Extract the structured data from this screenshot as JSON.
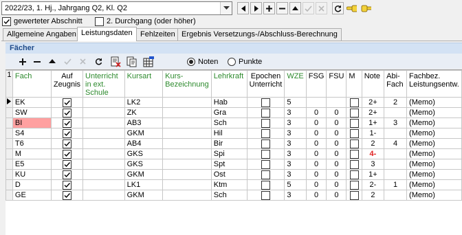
{
  "period": {
    "selected": "2022/23, 1. Hj., Jahrgang Q2, Kl. Q2"
  },
  "nav_buttons": [
    {
      "icon": "first-record-icon",
      "glyph": "◀"
    },
    {
      "icon": "next-record-icon",
      "glyph": "▶"
    },
    {
      "icon": "add-icon",
      "glyph": "+"
    },
    {
      "icon": "remove-icon",
      "glyph": "−"
    },
    {
      "icon": "up-icon",
      "glyph": "▲"
    },
    {
      "icon": "confirm-icon",
      "glyph": "✓"
    },
    {
      "icon": "cancel-icon",
      "glyph": "✕"
    },
    {
      "icon": "refresh-icon",
      "glyph": "↻"
    }
  ],
  "options": {
    "gewerteter_label": "gewerteter Abschnitt",
    "gewerteter_checked": true,
    "durchgang_label": "2. Durchgang (oder höher)",
    "durchgang_checked": false
  },
  "tabs": [
    {
      "label": "Allgemeine Angaben",
      "active": false
    },
    {
      "label": "Leistungsdaten",
      "active": true
    },
    {
      "label": "Fehlzeiten",
      "active": false
    },
    {
      "label": "Ergebnis Versetzungs-/Abschluss-Berechnung",
      "active": false
    }
  ],
  "section": {
    "title": "Fächer",
    "radio_noten": "Noten",
    "radio_punkte": "Punkte",
    "noten_selected": true
  },
  "columns": [
    {
      "label": "Fach",
      "green": true
    },
    {
      "label": "Auf Zeugnis",
      "green": false
    },
    {
      "label": "Unterricht in ext. Schule",
      "green": true
    },
    {
      "label": "Kursart",
      "green": true
    },
    {
      "label": "Kurs-Bezeichnung",
      "green": true
    },
    {
      "label": "Lehrkraft",
      "green": true
    },
    {
      "label": "Epochen Unterricht",
      "green": false
    },
    {
      "label": "WZE",
      "green": true
    },
    {
      "label": "FSG",
      "green": false
    },
    {
      "label": "FSU",
      "green": false
    },
    {
      "label": "M",
      "green": false
    },
    {
      "label": "Note",
      "green": false
    },
    {
      "label": "Abi-Fach",
      "green": false
    },
    {
      "label": "Fachbez. Leistungsentw.",
      "green": false
    }
  ],
  "row_indicator_label": "1",
  "rows": [
    {
      "fach": "EK",
      "zeugnis": true,
      "ext": "",
      "kursart": "LK2",
      "kurs": "",
      "lehrkraft": "Hab",
      "epochen": false,
      "wze": "5",
      "fsg": "",
      "fsu": "",
      "m": false,
      "note": "2+",
      "abi": "2",
      "memo": "(Memo)",
      "current": true,
      "highlight": false,
      "red": false
    },
    {
      "fach": "SW",
      "zeugnis": true,
      "ext": "",
      "kursart": "ZK",
      "kurs": "",
      "lehrkraft": "Gra",
      "epochen": false,
      "wze": "3",
      "fsg": "0",
      "fsu": "0",
      "m": false,
      "note": "2+",
      "abi": "",
      "memo": "(Memo)",
      "current": false,
      "highlight": false,
      "red": false
    },
    {
      "fach": "BI",
      "zeugnis": true,
      "ext": "",
      "kursart": "AB3",
      "kurs": "",
      "lehrkraft": "Sch",
      "epochen": false,
      "wze": "3",
      "fsg": "0",
      "fsu": "0",
      "m": false,
      "note": "1+",
      "abi": "3",
      "memo": "(Memo)",
      "current": false,
      "highlight": true,
      "red": false
    },
    {
      "fach": "S4",
      "zeugnis": true,
      "ext": "",
      "kursart": "GKM",
      "kurs": "",
      "lehrkraft": "Hil",
      "epochen": false,
      "wze": "3",
      "fsg": "0",
      "fsu": "0",
      "m": false,
      "note": "1-",
      "abi": "",
      "memo": "(Memo)",
      "current": false,
      "highlight": false,
      "red": false
    },
    {
      "fach": "T6",
      "zeugnis": true,
      "ext": "",
      "kursart": "AB4",
      "kurs": "",
      "lehrkraft": "Bir",
      "epochen": false,
      "wze": "3",
      "fsg": "0",
      "fsu": "0",
      "m": false,
      "note": "2",
      "abi": "4",
      "memo": "(Memo)",
      "current": false,
      "highlight": false,
      "red": false
    },
    {
      "fach": "M",
      "zeugnis": true,
      "ext": "",
      "kursart": "GKS",
      "kurs": "",
      "lehrkraft": "Spi",
      "epochen": false,
      "wze": "3",
      "fsg": "0",
      "fsu": "0",
      "m": false,
      "note": "4-",
      "abi": "",
      "memo": "(Memo)",
      "current": false,
      "highlight": false,
      "red": true
    },
    {
      "fach": "E5",
      "zeugnis": true,
      "ext": "",
      "kursart": "GKS",
      "kurs": "",
      "lehrkraft": "Spt",
      "epochen": false,
      "wze": "3",
      "fsg": "0",
      "fsu": "0",
      "m": false,
      "note": "3",
      "abi": "",
      "memo": "(Memo)",
      "current": false,
      "highlight": false,
      "red": false
    },
    {
      "fach": "KU",
      "zeugnis": true,
      "ext": "",
      "kursart": "GKM",
      "kurs": "",
      "lehrkraft": "Ost",
      "epochen": false,
      "wze": "3",
      "fsg": "0",
      "fsu": "0",
      "m": false,
      "note": "1+",
      "abi": "",
      "memo": "(Memo)",
      "current": false,
      "highlight": false,
      "red": false
    },
    {
      "fach": "D",
      "zeugnis": true,
      "ext": "",
      "kursart": "LK1",
      "kurs": "",
      "lehrkraft": "Ktm",
      "epochen": false,
      "wze": "5",
      "fsg": "0",
      "fsu": "0",
      "m": false,
      "note": "2-",
      "abi": "1",
      "memo": "(Memo)",
      "current": false,
      "highlight": false,
      "red": false
    },
    {
      "fach": "GE",
      "zeugnis": true,
      "ext": "",
      "kursart": "GKM",
      "kurs": "",
      "lehrkraft": "Sch",
      "epochen": false,
      "wze": "3",
      "fsg": "0",
      "fsu": "0",
      "m": false,
      "note": "2",
      "abi": "",
      "memo": "(Memo)",
      "current": false,
      "highlight": false,
      "red": false
    }
  ]
}
